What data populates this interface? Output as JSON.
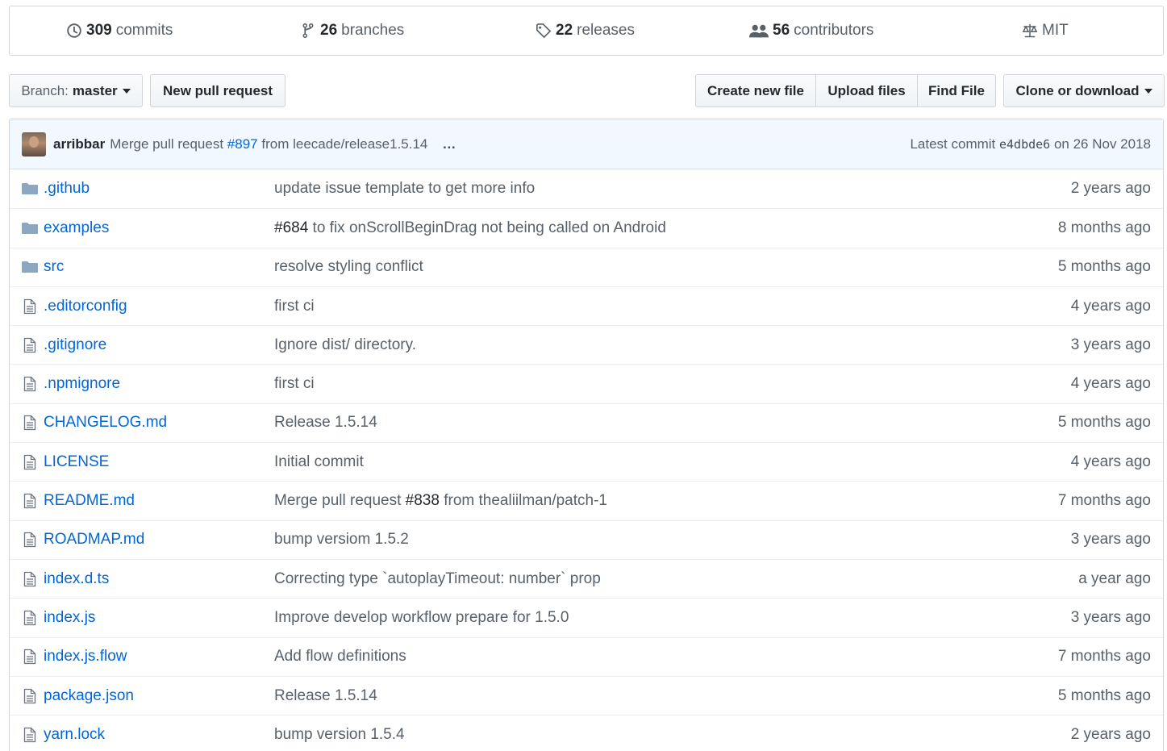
{
  "summary": {
    "commits": {
      "count": "309",
      "label": "commits"
    },
    "branches": {
      "count": "26",
      "label": "branches"
    },
    "releases": {
      "count": "22",
      "label": "releases"
    },
    "contributors": {
      "count": "56",
      "label": "contributors"
    },
    "license": {
      "label": "MIT"
    }
  },
  "toolbar": {
    "branch_prefix": "Branch:",
    "branch_name": "master",
    "new_pull_request": "New pull request",
    "create_new_file": "Create new file",
    "upload_files": "Upload files",
    "find_file": "Find File",
    "clone_or_download": "Clone or download"
  },
  "latest_commit": {
    "author": "arribbar",
    "message_prefix": "Merge pull request",
    "pr_link": "#897",
    "message_suffix": "from leecade/release1.5.14",
    "ellipsis": "…",
    "label": "Latest commit",
    "sha": "e4dbde6",
    "date": "on 26 Nov 2018"
  },
  "files": [
    {
      "type": "folder",
      "name": ".github",
      "message": "update issue template to get more info",
      "age": "2 years ago"
    },
    {
      "type": "folder",
      "name": "examples",
      "message_link": "#684",
      "message": " to fix onScrollBeginDrag not being called on Android",
      "age": "8 months ago"
    },
    {
      "type": "folder",
      "name": "src",
      "message": "resolve styling conflict",
      "age": "5 months ago"
    },
    {
      "type": "file",
      "name": ".editorconfig",
      "message": "first ci",
      "age": "4 years ago"
    },
    {
      "type": "file",
      "name": ".gitignore",
      "message": "Ignore dist/ directory.",
      "age": "3 years ago"
    },
    {
      "type": "file",
      "name": ".npmignore",
      "message": "first ci",
      "age": "4 years ago"
    },
    {
      "type": "file",
      "name": "CHANGELOG.md",
      "message": "Release 1.5.14",
      "age": "5 months ago"
    },
    {
      "type": "file",
      "name": "LICENSE",
      "message": "Initial commit",
      "age": "4 years ago"
    },
    {
      "type": "file",
      "name": "README.md",
      "message_prefix": "Merge pull request ",
      "message_link": "#838",
      "message": " from thealiilman/patch-1",
      "age": "7 months ago"
    },
    {
      "type": "file",
      "name": "ROADMAP.md",
      "message": "bump versiom 1.5.2",
      "age": "3 years ago"
    },
    {
      "type": "file",
      "name": "index.d.ts",
      "message": "Correcting type `autoplayTimeout: number` prop",
      "age": "a year ago"
    },
    {
      "type": "file",
      "name": "index.js",
      "message": "Improve develop workflow prepare for 1.5.0",
      "age": "3 years ago"
    },
    {
      "type": "file",
      "name": "index.js.flow",
      "message": "Add flow definitions",
      "age": "7 months ago"
    },
    {
      "type": "file",
      "name": "package.json",
      "message": "Release 1.5.14",
      "age": "5 months ago"
    },
    {
      "type": "file",
      "name": "yarn.lock",
      "message": "bump version 1.5.4",
      "age": "2 years ago"
    }
  ],
  "colors": {
    "link": "#0366d6",
    "folder": "#79b8ff",
    "muted": "#586069",
    "border": "#d1d5da"
  }
}
